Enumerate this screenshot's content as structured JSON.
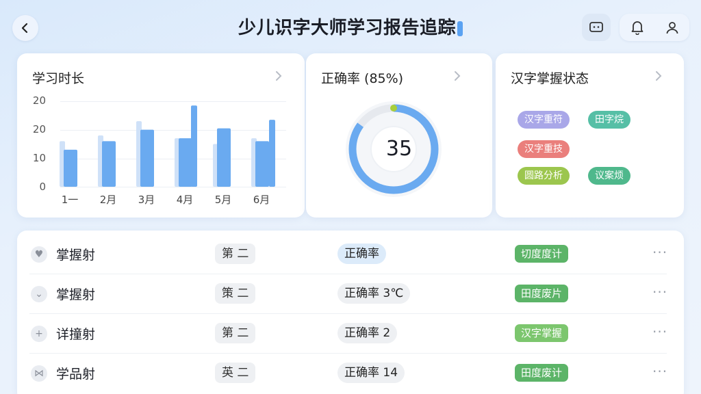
{
  "header": {
    "title": "少儿识字大师学习报告追踪",
    "back_icon": "chevron-left-icon",
    "chat_icon": "chat-icon",
    "bell_icon": "bell-icon",
    "user_icon": "user-icon"
  },
  "study_time_card": {
    "title": "学习时长",
    "chart_data": {
      "type": "bar",
      "categories": [
        "1一",
        "2月",
        "3月",
        "4月",
        "5月",
        "6月"
      ],
      "y_ticks": [
        "20",
        "20",
        "10",
        "0"
      ],
      "series": [
        {
          "values": [
            16,
            18,
            23,
            17,
            15,
            17
          ],
          "color": "#cfe1f8"
        },
        {
          "values": [
            13,
            16,
            20,
            17,
            20.5,
            16
          ],
          "color": "#6aaaf0"
        },
        {
          "values": [
            null,
            null,
            null,
            28.5,
            null,
            23.5
          ],
          "color": "#6aaaf0"
        }
      ],
      "ylim": [
        0,
        30
      ],
      "grid": true
    }
  },
  "accuracy_card": {
    "title": "正确率 (85%)",
    "center_value": "35",
    "progress": 0.85,
    "ring_color": "#6aaaf0",
    "track_color": "#e6e9ee",
    "marker_color": "#a8cf3c"
  },
  "mastery_card": {
    "title": "汉字掌握状态",
    "tags": [
      {
        "label": "汉字重符",
        "color": "#a9a7e8"
      },
      {
        "label": "田字烷",
        "color": "#56bfa6"
      },
      {
        "label": "汉字重技",
        "color": "#ea7f7c"
      },
      {
        "label": "圆路分析",
        "color": "#9cc64e"
      },
      {
        "label": "议案烦",
        "color": "#4fb88c"
      }
    ]
  },
  "list": {
    "rows": [
      {
        "icon": "heart-icon",
        "icon_glyph": "♥",
        "name": "掌握射",
        "rank": "第 二",
        "accuracy": "正确率",
        "accuracy_highlight": true,
        "status": "切度度计",
        "status_light": false
      },
      {
        "icon": "chevron-down-icon",
        "icon_glyph": "⌄",
        "name": "掌握射",
        "rank": "策 二",
        "accuracy": "正确率 3℃",
        "accuracy_highlight": false,
        "status": "田度废片",
        "status_light": false
      },
      {
        "icon": "plus-icon",
        "icon_glyph": "+",
        "name": "详撞射",
        "rank": "第 二",
        "accuracy": "正确率 2",
        "accuracy_highlight": false,
        "status": "汉字掌握",
        "status_light": true
      },
      {
        "icon": "link-icon",
        "icon_glyph": "⋈",
        "name": "学品射",
        "rank": "英 二",
        "accuracy": "正确率 14",
        "accuracy_highlight": false,
        "status": "田度废计",
        "status_light": false
      }
    ],
    "more_label": "···"
  }
}
